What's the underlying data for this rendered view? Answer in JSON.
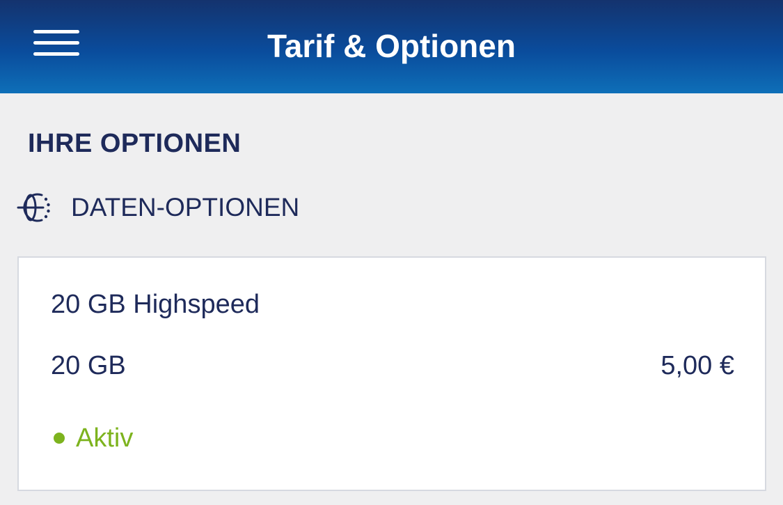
{
  "header": {
    "title": "Tarif & Optionen",
    "menu_icon": "hamburger-menu-icon"
  },
  "section": {
    "title": "IHRE OPTIONEN"
  },
  "category": {
    "icon": "globe-icon",
    "label": "DATEN-OPTIONEN"
  },
  "option": {
    "name": "20 GB Highspeed",
    "volume": "20 GB",
    "price": "5,00 €",
    "status": "Aktiv",
    "status_color": "#7db31e"
  },
  "colors": {
    "header_gradient_top": "#14336e",
    "header_gradient_bottom": "#0e6fb8",
    "text_primary": "#1e2a5a",
    "background": "#efeff0"
  }
}
